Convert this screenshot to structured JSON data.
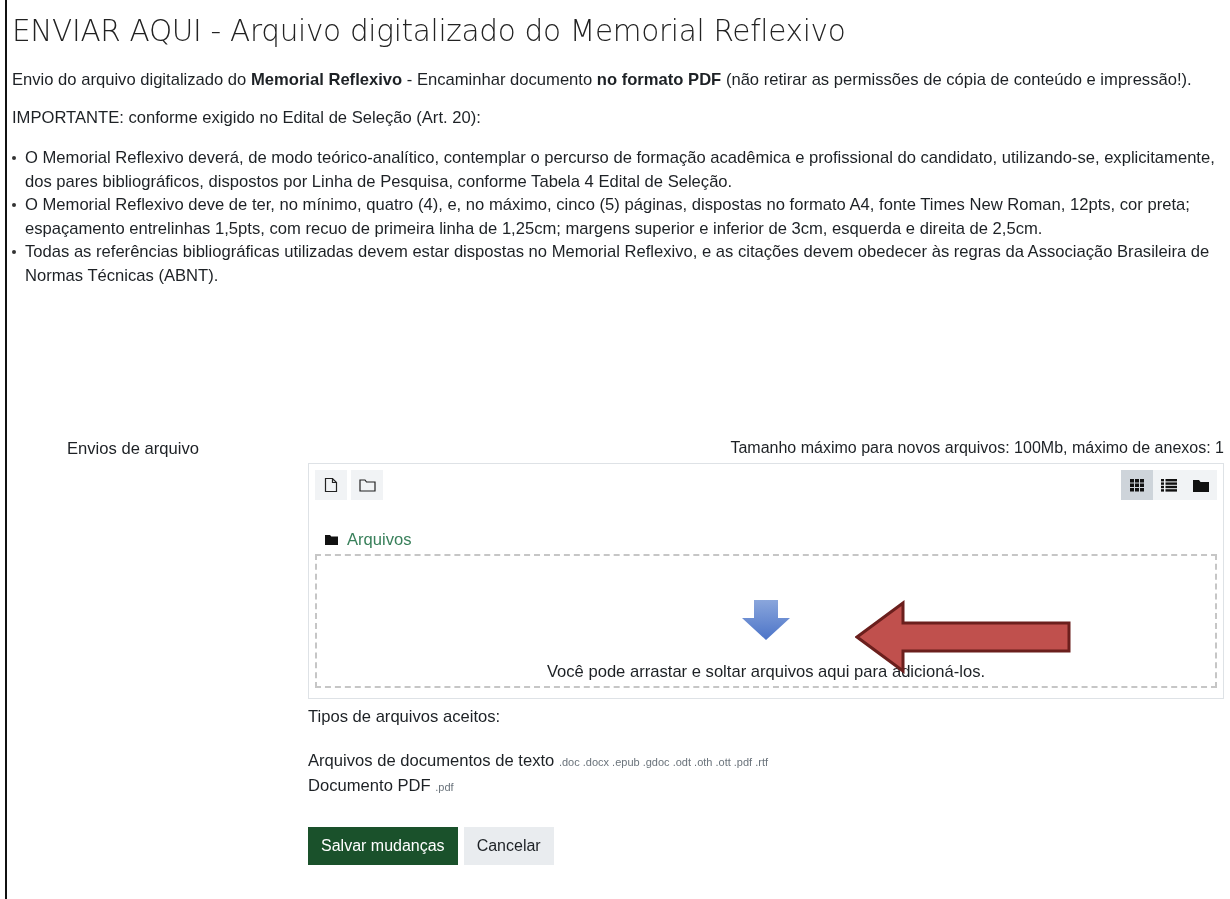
{
  "title": "ENVIAR AQUI - Arquivo digitalizado do Memorial Reflexivo",
  "intro": "Envio do arquivo digitalizado do **Memorial Reflexivo** - Encaminhar documento **no formato PDF** (não retirar as permissões de cópia de conteúdo e impressão!).",
  "important": "IMPORTANTE: conforme exigido no Edital de Seleção (Art. 20):",
  "requirements": [
    "O Memorial Reflexivo deverá, de modo teórico-analítico, contemplar o percurso de formação acadêmica e profissional do candidato, utilizando-se, explicitamente, dos pares bibliográficos, dispostos por Linha de Pesquisa, conforme Tabela 4 Edital de Seleção.",
    "O Memorial Reflexivo deve de ter, no mínimo, quatro (4), e, no máximo, cinco (5) páginas, dispostas no formato A4, fonte Times New Roman, 12pts, cor preta; espaçamento entrelinhas 1,5pts, com recuo de primeira linha de 1,25cm; margens superior e inferior de 3cm, esquerda e direita de 2,5cm.",
    "Todas as referências bibliográficas utilizadas devem estar dispostas no Memorial Reflexivo, e as citações devem obedecer às regras da Associação Brasileira de Normas Técnicas (ABNT)."
  ],
  "form": {
    "label": "Envios de arquivo",
    "limits": "Tamanho máximo para novos arquivos: 100Mb, máximo de anexos: 1",
    "toolbar": [
      {
        "kind": "file"
      },
      {
        "kind": "folder"
      }
    ],
    "views": [
      {
        "kind": "grid",
        "selected": true
      },
      {
        "kind": "list",
        "selected": false
      },
      {
        "kind": "tree",
        "selected": false
      }
    ],
    "breadcrumb": "Arquivos",
    "dropzone_text": "Você pode arrastar e soltar arquivos aqui para adicioná-los.",
    "accepted_label": "Tipos de arquivos aceitos:",
    "accepted": [
      {
        "name": "Arquivos de documentos de texto",
        "extensions": ".doc .docx .epub .gdoc .odt .oth .ott .pdf .rtf"
      },
      {
        "name": "Documento PDF",
        "extensions": ".pdf"
      }
    ],
    "buttons": [
      {
        "label": "Salvar mudanças",
        "kind": "primary"
      },
      {
        "label": "Cancelar",
        "kind": "secondary"
      }
    ]
  }
}
